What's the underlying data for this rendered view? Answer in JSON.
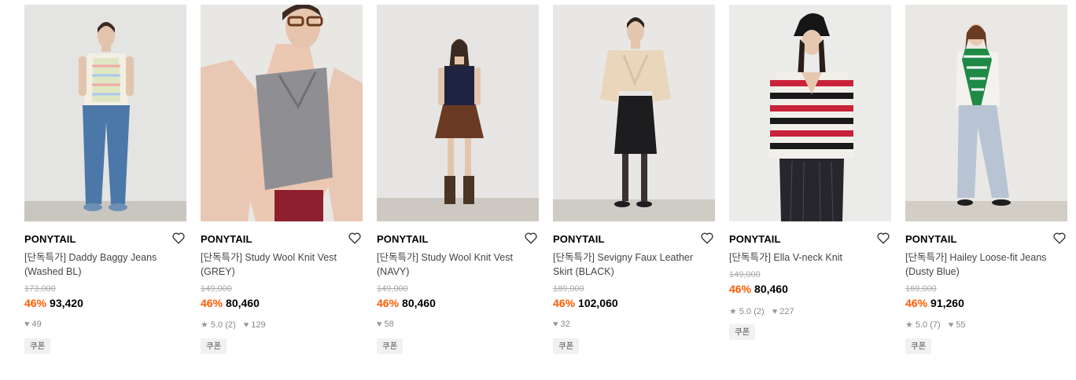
{
  "products": [
    {
      "brand": "PONYTAIL",
      "name": "[단독특가] Daddy Baggy Jeans (Washed BL)",
      "original_price": "173,000",
      "discount": "46%",
      "price": "93,420",
      "rating": "",
      "review_count": "",
      "likes": "49",
      "badge": "쿠폰",
      "image_alt": "model in striped knit vest and wide blue jeans"
    },
    {
      "brand": "PONYTAIL",
      "name": "[단독특가] Study Wool Knit Vest (GREY)",
      "original_price": "149,000",
      "discount": "46%",
      "price": "80,460",
      "rating": "5.0",
      "review_count": "(2)",
      "likes": "129",
      "badge": "쿠폰",
      "image_alt": "model in grey knit vest over pink striped shirt"
    },
    {
      "brand": "PONYTAIL",
      "name": "[단독특가] Study Wool Knit Vest (NAVY)",
      "original_price": "149,000",
      "discount": "46%",
      "price": "80,460",
      "rating": "",
      "review_count": "",
      "likes": "58",
      "badge": "쿠폰",
      "image_alt": "model in navy knit vest and brown pleated skirt"
    },
    {
      "brand": "PONYTAIL",
      "name": "[단독특가] Sevigny Faux Leather Skirt (BLACK)",
      "original_price": "189,000",
      "discount": "46%",
      "price": "102,060",
      "rating": "",
      "review_count": "",
      "likes": "32",
      "badge": "쿠폰",
      "image_alt": "model in beige cardigan and black leather skirt"
    },
    {
      "brand": "PONYTAIL",
      "name": "[단독특가] Ella V-neck Knit",
      "original_price": "149,000",
      "discount": "46%",
      "price": "80,460",
      "rating": "5.0",
      "review_count": "(2)",
      "likes": "227",
      "badge": "쿠폰",
      "image_alt": "model in red white black striped v-neck knit and beanie"
    },
    {
      "brand": "PONYTAIL",
      "name": "[단독특가] Hailey Loose-fit Jeans (Dusty Blue)",
      "original_price": "169,000",
      "discount": "46%",
      "price": "91,260",
      "rating": "5.0",
      "review_count": "(7)",
      "likes": "55",
      "badge": "쿠폰",
      "image_alt": "model in green striped scarf and light blue jeans"
    }
  ],
  "colors": {
    "discount": "#ff5a00",
    "muted": "#888888",
    "badge_bg": "#f1f1f1"
  }
}
